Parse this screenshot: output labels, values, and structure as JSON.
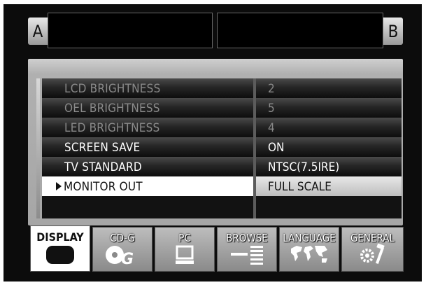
{
  "decks": [
    {
      "label": "A"
    },
    {
      "label": "B"
    }
  ],
  "settings": [
    {
      "name": "LCD BRIGHTNESS",
      "value": "2",
      "state": "disabled"
    },
    {
      "name": "OEL BRIGHTNESS",
      "value": "5",
      "state": "disabled"
    },
    {
      "name": "LED BRIGHTNESS",
      "value": "4",
      "state": "disabled"
    },
    {
      "name": "SCREEN SAVE",
      "value": "ON",
      "state": "enabled"
    },
    {
      "name": "TV STANDARD",
      "value": "NTSC(7.5IRE)",
      "state": "enabled"
    },
    {
      "name": "MONITOR OUT",
      "value": "FULL SCALE",
      "state": "selected"
    }
  ],
  "tabs": [
    {
      "label": "DISPLAY",
      "icon": "display-icon",
      "active": true
    },
    {
      "label": "CD-G",
      "icon": "cdg-disc-icon",
      "active": false
    },
    {
      "label": "PC",
      "icon": "computer-icon",
      "active": false
    },
    {
      "label": "BROWSE",
      "icon": "browse-list-icon",
      "active": false
    },
    {
      "label": "LANGUAGE",
      "icon": "world-map-icon",
      "active": false
    },
    {
      "label": "GENERAL",
      "icon": "tools-icon",
      "active": false
    }
  ]
}
